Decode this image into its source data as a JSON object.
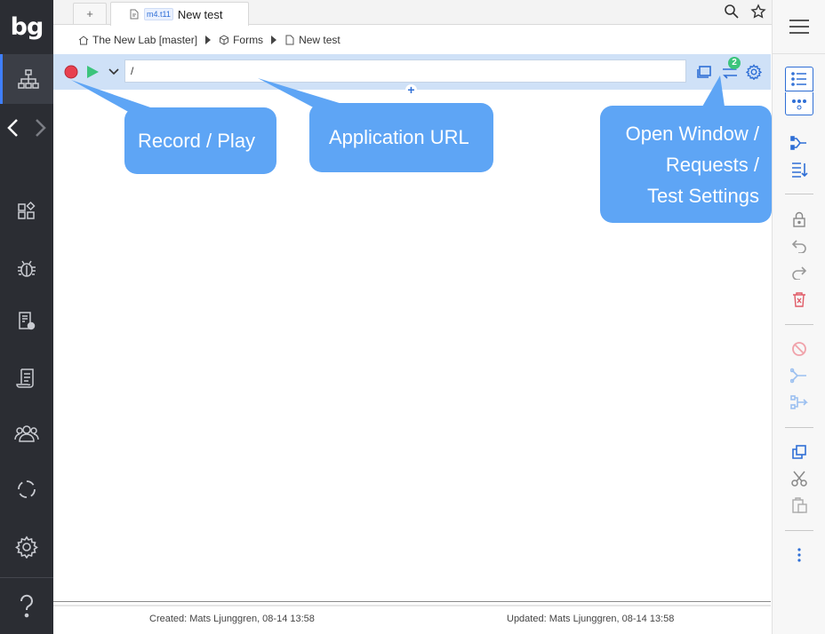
{
  "app": {
    "logo_text": "bg"
  },
  "tabs": {
    "new_tab_label": "+",
    "active_tab": {
      "badge": "m4.t11",
      "label": "New test"
    }
  },
  "breadcrumb": [
    {
      "label": "The New Lab [master]",
      "icon": "home-icon"
    },
    {
      "label": "Forms",
      "icon": "cube-icon"
    },
    {
      "label": "New test",
      "icon": "test-icon"
    }
  ],
  "toolbar": {
    "url_value": "/",
    "requests_count": "2",
    "add_step_label": "+"
  },
  "callouts": {
    "record_play": "Record / Play",
    "app_url": "Application URL",
    "open_window_line1": "Open Window /",
    "open_window_line2": "Requests /",
    "open_window_line3": "Test Settings"
  },
  "left_nav": [
    "sitemap-icon",
    "back-icon",
    "forward-icon",
    "components-icon",
    "bug-icon",
    "bug-report-icon",
    "script-icon",
    "team-icon",
    "sync-icon",
    "settings-icon",
    "help-icon"
  ],
  "right_toolbar": [
    "list-view-icon",
    "more-dots-icon",
    "split-icon",
    "sort-icon",
    "lock-icon",
    "undo-icon",
    "redo-icon",
    "delete-icon",
    "disable-icon",
    "branch-icon",
    "merge-icon",
    "copy-icon",
    "cut-icon",
    "paste-icon",
    "kebab-icon"
  ],
  "footer": {
    "created": "Created: Mats Ljunggren, 08-14 13:58",
    "updated": "Updated: Mats Ljunggren, 08-14 13:58"
  },
  "colors": {
    "sidebar_bg": "#2b2d33",
    "toolbar_bg": "#cfe1f7",
    "callout_bg": "#5ea5f5",
    "accent": "#2f6fd6",
    "record": "#e8404f",
    "play": "#3cc47c",
    "badge": "#3cc47c"
  }
}
